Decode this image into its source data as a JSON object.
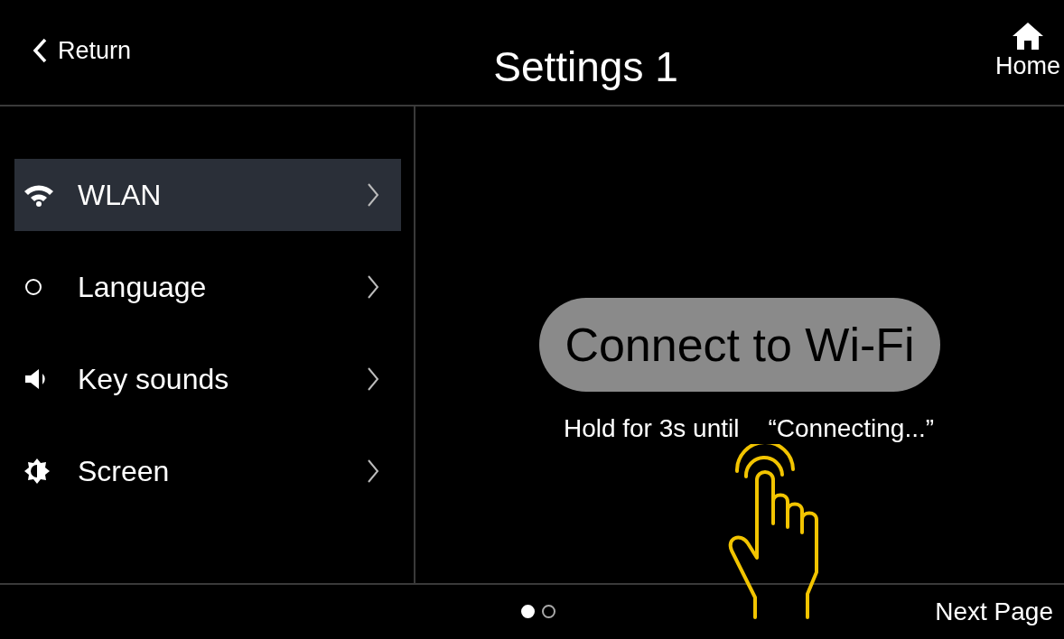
{
  "header": {
    "back": "Return",
    "title": "Settings 1",
    "home": "Home"
  },
  "menu": [
    {
      "kind": "wifi",
      "label": "WLAN",
      "selected": true
    },
    {
      "kind": "circle",
      "label": "Language",
      "selected": false
    },
    {
      "kind": "speaker",
      "label": "Key sounds",
      "selected": false
    },
    {
      "kind": "brightness",
      "label": "Screen",
      "selected": false
    }
  ],
  "content": {
    "button": "Connect to Wi-Fi",
    "hint": "Hold for 3s until",
    "status": "“Connecting...”"
  },
  "pager": [
    {
      "selected": true
    },
    {
      "selected": false
    }
  ],
  "footer": {
    "next": "Next Page"
  }
}
